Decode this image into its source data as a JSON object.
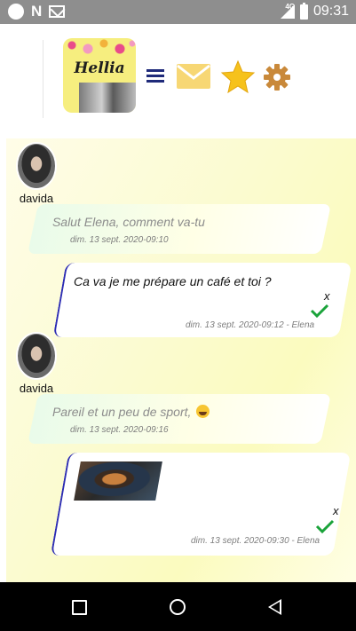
{
  "status_bar": {
    "network_type": "4G",
    "time": "09:31"
  },
  "header": {
    "logo_text": "Hellia",
    "icons": [
      "menu-icon",
      "mail-icon",
      "star-icon",
      "gear-icon"
    ],
    "colors": {
      "menu": "#1f2a7a",
      "mail": "#f7d774",
      "star": "#f6c21c",
      "gear": "#c9893a"
    }
  },
  "messages": [
    {
      "type": "incoming",
      "sender": "davida",
      "text": "Salut Elena, comment va-tu",
      "timestamp": "dim. 13 sept. 2020-09:10"
    },
    {
      "type": "outgoing",
      "text": "Ca va je me prépare un café et toi ?",
      "delete_label": "x",
      "meta": "dim. 13 sept. 2020-09:12 - Elena",
      "status": "read"
    },
    {
      "type": "incoming",
      "sender": "davida",
      "text": "Pareil et un peu de sport,",
      "emoji": "grinning-face",
      "timestamp": "dim. 13 sept. 2020-09:16"
    },
    {
      "type": "outgoing",
      "image": "coffee-cup-photo",
      "delete_label": "x",
      "meta": "dim. 13 sept. 2020-09:30 - Elena",
      "status": "read"
    }
  ],
  "colors": {
    "outgoing_border": "#2b2bb3",
    "check": "#1aa33a",
    "chat_background": "#fbfbd2"
  },
  "nav": [
    "recent-apps",
    "home",
    "back"
  ]
}
